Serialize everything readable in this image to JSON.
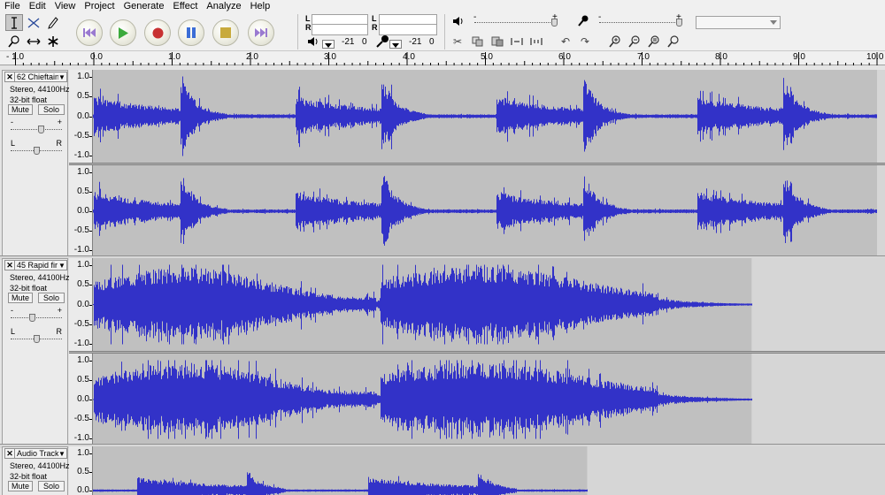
{
  "menu": [
    "File",
    "Edit",
    "View",
    "Project",
    "Generate",
    "Effect",
    "Analyze",
    "Help"
  ],
  "tools": {
    "selection_icon": "ibeam-icon",
    "envelope_icon": "envelope-icon",
    "draw_icon": "pencil-icon",
    "zoom_icon": "magnifier-icon",
    "timeshift_icon": "double-arrow-icon",
    "multi_icon": "asterisk-icon"
  },
  "transport": {
    "skip_start": "skip-to-start-icon",
    "play": "play-icon",
    "record": "record-icon",
    "pause": "pause-icon",
    "stop": "stop-icon",
    "skip_end": "skip-to-end-icon"
  },
  "meters": {
    "left_channel": "L",
    "right_channel": "R",
    "play_db": "-21",
    "play_zero": "0",
    "rec_db": "-21",
    "rec_zero": "0"
  },
  "mixer": {
    "output_minus": "-",
    "output_plus": "+",
    "input_minus": "-",
    "input_plus": "+"
  },
  "ruler": {
    "labels": [
      "- 1.0",
      "0.0",
      "1.0",
      "2.0",
      "3.0",
      "4.0",
      "5.0",
      "6.0",
      "7.0",
      "8.0",
      "9.0",
      "10.0"
    ],
    "values": [
      -1,
      0,
      1,
      2,
      3,
      4,
      5,
      6,
      7,
      8,
      9,
      10
    ]
  },
  "scale_labels": [
    "1.0",
    "0.5",
    "0.0",
    "-0.5",
    "-1.0"
  ],
  "tracks": [
    {
      "name": "62 Chieftain",
      "format": "Stereo, 44100Hz",
      "depth": "32-bit float",
      "mute": "Mute",
      "solo": "Solo",
      "gain_minus": "-",
      "gain_plus": "+",
      "pan_left": "L",
      "pan_right": "R",
      "gain_level": 0.6,
      "pan_level": 0.5,
      "clip_end_seconds": 10.0
    },
    {
      "name": "45 Rapid fir",
      "format": "Stereo, 44100Hz",
      "depth": "32-bit float",
      "mute": "Mute",
      "solo": "Solo",
      "gain_minus": "-",
      "gain_plus": "+",
      "pan_left": "L",
      "pan_right": "R",
      "gain_level": 0.42,
      "pan_level": 0.5,
      "clip_end_seconds": 8.4
    },
    {
      "name": "Audio Track",
      "format": "Stereo, 44100Hz",
      "depth": "32-bit float",
      "mute": "Mute",
      "solo": "Solo",
      "clip_end_seconds": 6.3
    }
  ]
}
